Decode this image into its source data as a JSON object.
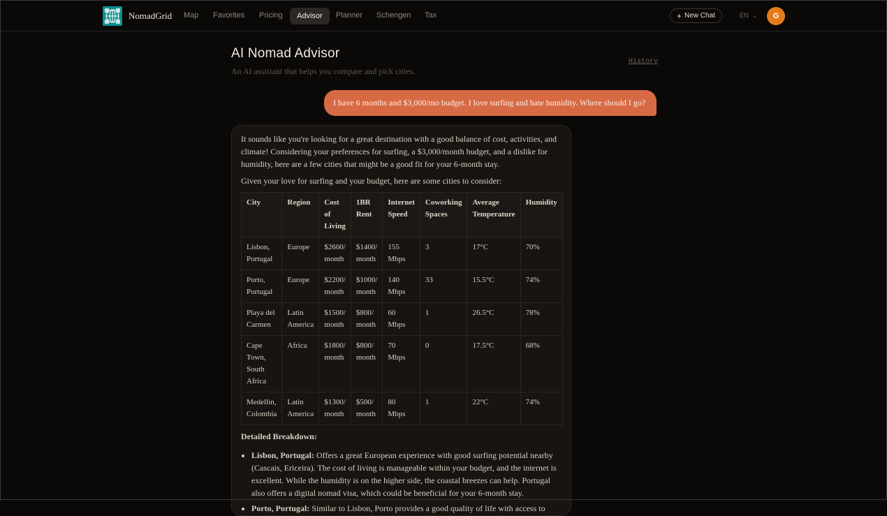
{
  "nav": {
    "brand": "NomadGrid",
    "links": [
      "Map",
      "Favorites",
      "Pricing",
      "Advisor",
      "Planner",
      "Schengen",
      "Tax"
    ],
    "active": "Advisor",
    "new_chat": "New Chat",
    "lang": "EN",
    "avatar": "G"
  },
  "header": {
    "title": "AI Nomad Advisor",
    "subtitle": "An AI assistant that helps you compare and pick cities.",
    "history": "History"
  },
  "chat": {
    "user_message": "I have 6 months and $3,000/mo budget. I love surfing and hate humidity. Where should I go?",
    "assistant": {
      "intro": "It sounds like you're looking for a great destination with a good balance of cost, activities, and climate! Considering your preferences for surfing, a $3,000/month budget, and a dislike for humidity, here are a few cities that might be a good fit for your 6-month stay.",
      "lead": "Given your love for surfing and your budget, here are some cities to consider:",
      "table": {
        "headers": [
          "City",
          "Region",
          "Cost of Living",
          "1BR Rent",
          "Internet Speed",
          "Coworking Spaces",
          "Average Temperature",
          "Humidity"
        ],
        "rows": [
          [
            "Lisbon, Portugal",
            "Europe",
            "$2600/ month",
            "$1400/ month",
            "155 Mbps",
            "3",
            "17°C",
            "70%"
          ],
          [
            "Porto, Portugal",
            "Europe",
            "$2200/ month",
            "$1000/ month",
            "140 Mbps",
            "33",
            "15.5°C",
            "74%"
          ],
          [
            "Playa del Carmen",
            "Latin America",
            "$1500/ month",
            "$800/ month",
            "60 Mbps",
            "1",
            "26.5°C",
            "78%"
          ],
          [
            "Cape Town, South Africa",
            "Africa",
            "$1800/ month",
            "$800/ month",
            "70 Mbps",
            "0",
            "17.5°C",
            "68%"
          ],
          [
            "Medellin, Colombia",
            "Latin America",
            "$1300/ month",
            "$500/ month",
            "80 Mbps",
            "1",
            "22°C",
            "74%"
          ]
        ]
      },
      "breakdown_title": "Detailed Breakdown:",
      "bullets": [
        {
          "bold": "Lisbon, Portugal:",
          "text": " Offers a great European experience with good surfing potential nearby (Cascais, Ericeira). The cost of living is manageable within your budget, and the internet is excellent. While the humidity is on the higher side, the coastal breezes can help. Portugal also offers a digital nomad visa, which could be beneficial for your 6-month stay."
        },
        {
          "bold": "Porto, Portugal:",
          "text": " Similar to Lisbon, Porto provides a good quality of life with access to"
        }
      ]
    }
  }
}
